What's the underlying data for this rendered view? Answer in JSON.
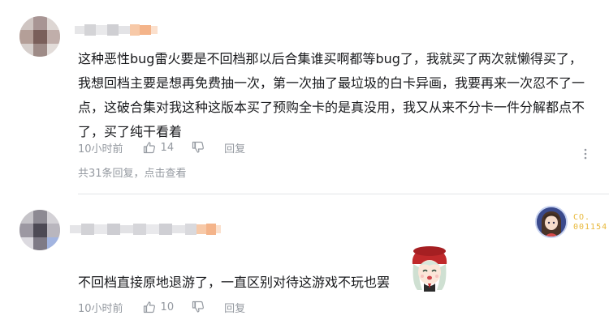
{
  "comments": [
    {
      "content_lines": [
        "这种恶性bug雷火要是不回档那以后合集谁买啊都等bug了，我就买了两次就懒得买了，",
        "我想回档主要是想再免费抽一次，第一次抽了最垃圾的白卡异画，我要再来一次忍不了一",
        "点，这破合集对我这种这版本买了预购全卡的是真没用，我又从来不分卡一件分解都点不",
        "了，买了纯干看着"
      ],
      "time": "10小时前",
      "like_count": "14",
      "reply_label": "回复",
      "replies_summary_prefix": "共31条回复，",
      "replies_summary_link": "点击查看"
    },
    {
      "fan_badge_text": [
        "CO.",
        "001154"
      ],
      "content_lines": [
        "不回档直接原地退游了，一直区别对待这游戏不玩也罢"
      ],
      "time": "10小时前",
      "like_count": "10",
      "reply_label": "回复"
    }
  ],
  "colors": {
    "text_primary": "#18191c",
    "text_secondary": "#9499a0",
    "divider": "#e3e5e7",
    "badge_gold": "#e8b83a",
    "name_blur_orange": "#f7c9a8"
  },
  "icons": [
    "thumbs-up-icon",
    "thumbs-down-icon",
    "more-vertical-icon",
    "fan-badge-icon",
    "sticker-girl"
  ]
}
